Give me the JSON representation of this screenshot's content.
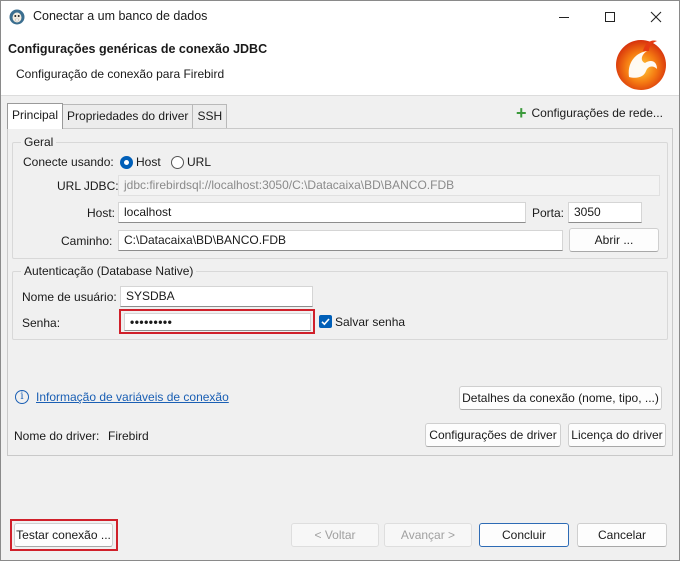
{
  "window": {
    "title": "Conectar a um banco de dados"
  },
  "header": {
    "title": "Configurações genéricas de conexão JDBC",
    "subtitle": "Configuração de conexão para Firebird"
  },
  "tabs": [
    {
      "label": "Principal",
      "active": true
    },
    {
      "label": "Propriedades do driver",
      "active": false
    },
    {
      "label": "SSH",
      "active": false
    }
  ],
  "network_config_label": "Configurações de rede...",
  "general": {
    "legend": "Geral",
    "connect_using_label": "Conecte usando:",
    "option_host": "Host",
    "option_url": "URL",
    "selected": "Host",
    "url_label": "URL JDBC:",
    "url_value": "jdbc:firebirdsql://localhost:3050/C:\\Datacaixa\\BD\\BANCO.FDB",
    "host_label": "Host:",
    "host_value": "localhost",
    "port_label": "Porta:",
    "port_value": "3050",
    "path_label": "Caminho:",
    "path_value": "C:\\Datacaixa\\BD\\BANCO.FDB",
    "open_button": "Abrir ..."
  },
  "auth": {
    "legend": "Autenticação (Database Native)",
    "username_label": "Nome de usuário:",
    "username_value": "SYSDBA",
    "password_label": "Senha:",
    "password_value": "•••••••••",
    "save_password_label": "Salvar senha",
    "save_password_checked": true
  },
  "info_link": "Informação de variáveis de conexão",
  "details_button": "Detalhes da conexão (nome, tipo, ...)",
  "driver": {
    "label": "Nome do driver:",
    "value": "Firebird",
    "config_button": "Configurações de driver",
    "license_button": "Licença do driver"
  },
  "footer": {
    "test_button": "Testar conexão ...",
    "back_button": "< Voltar",
    "next_button": "Avançar >",
    "finish_button": "Concluir",
    "cancel_button": "Cancelar"
  },
  "colors": {
    "accent": "#005fb8",
    "highlight": "#d0202a",
    "add_icon": "#3c9a3c",
    "link": "#1a5fb4"
  }
}
